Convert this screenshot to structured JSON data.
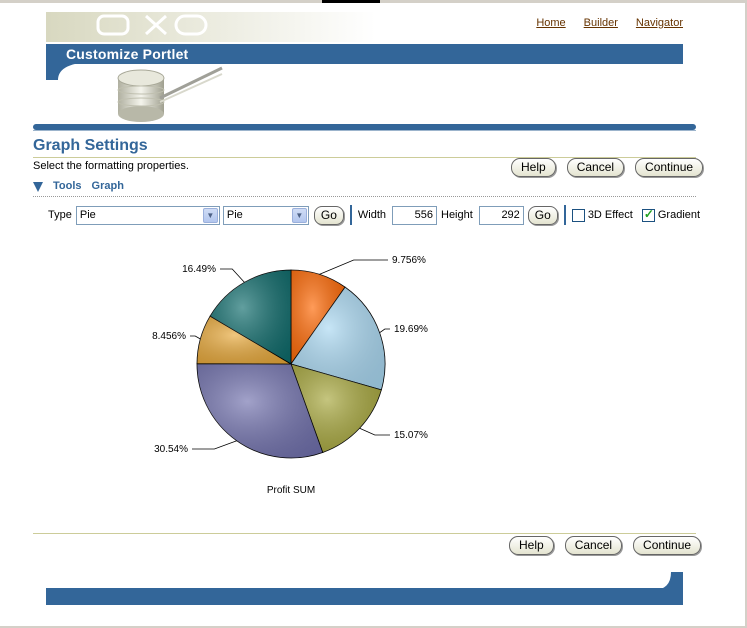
{
  "header": {
    "nav_links": [
      "Home",
      "Builder",
      "Navigator"
    ],
    "banner_title": "Customize Portlet"
  },
  "section": {
    "title": "Graph Settings",
    "instruction": "Select the formatting properties."
  },
  "buttons": {
    "help": "Help",
    "cancel": "Cancel",
    "continue": "Continue"
  },
  "tools": {
    "tools_label": "Tools",
    "graph_label": "Graph"
  },
  "controls": {
    "type_label": "Type",
    "type_value": "Pie",
    "subtype_value": "Pie",
    "go_label": "Go",
    "width_label": "Width",
    "width_value": "556",
    "height_label": "Height",
    "height_value": "292",
    "effect_3d_label": "3D Effect",
    "effect_3d_checked": false,
    "gradient_label": "Gradient",
    "gradient_checked": true
  },
  "chart_data": {
    "type": "pie",
    "title": "Profit SUM",
    "slices": [
      {
        "label": "9.756%",
        "value": 9.756,
        "color": "#ff6600"
      },
      {
        "label": "19.69%",
        "value": 19.69,
        "color": "#a9d8f2"
      },
      {
        "label": "15.07%",
        "value": 15.07,
        "color": "#a6a63a"
      },
      {
        "label": "30.54%",
        "value": 30.54,
        "color": "#7070ad"
      },
      {
        "label": "8.456%",
        "value": 8.456,
        "color": "#e8a838"
      },
      {
        "label": "16.49%",
        "value": 16.49,
        "color": "#0d6b6b"
      }
    ]
  }
}
